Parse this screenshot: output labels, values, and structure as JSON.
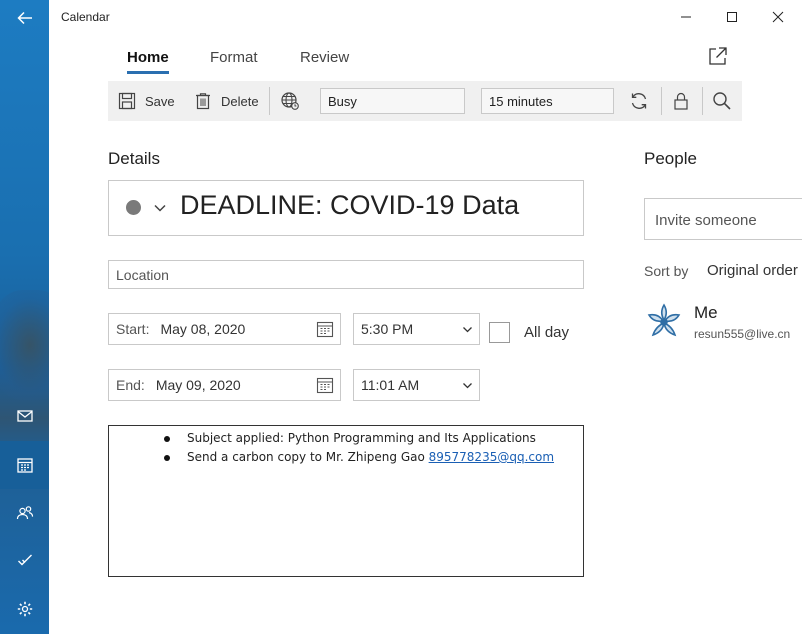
{
  "window": {
    "title": "Calendar"
  },
  "colors": {
    "rail": "#1a6fb0",
    "accent": "#2a6fb0",
    "link": "#1a5fb4",
    "toolbar_bg": "#f0f0f0"
  },
  "nav": {
    "icons": [
      "back-arrow-icon",
      "mail-icon",
      "calendar-icon",
      "people-icon",
      "todo-icon",
      "settings-icon"
    ],
    "active": "calendar"
  },
  "tabs": [
    {
      "label": "Home",
      "active": true
    },
    {
      "label": "Format",
      "active": false
    },
    {
      "label": "Review",
      "active": false
    }
  ],
  "toolbar": {
    "save_label": "Save",
    "delete_label": "Delete",
    "show_as": "Busy",
    "reminder": "15 minutes"
  },
  "details": {
    "heading": "Details",
    "event_title": "DEADLINE: COVID-19 Data",
    "location_placeholder": "Location",
    "start_label": "Start:",
    "start_date": "May 08, 2020",
    "start_time": "5:30 PM",
    "end_label": "End:",
    "end_date": "May 09, 2020",
    "end_time": "11:01 AM",
    "all_day_label": "All day",
    "all_day_checked": false
  },
  "notes": {
    "line1": "Subject applied: Python Programming and Its Applications",
    "line2_prefix": "Send a carbon copy to Mr. Zhipeng Gao ",
    "line2_link": "895778235@qq.com"
  },
  "people": {
    "heading": "People",
    "invite_placeholder": "Invite someone",
    "sort_label": "Sort by",
    "sort_value": "Original order",
    "attendees": [
      {
        "name": "Me",
        "email": "resun555@live.cn"
      }
    ]
  }
}
